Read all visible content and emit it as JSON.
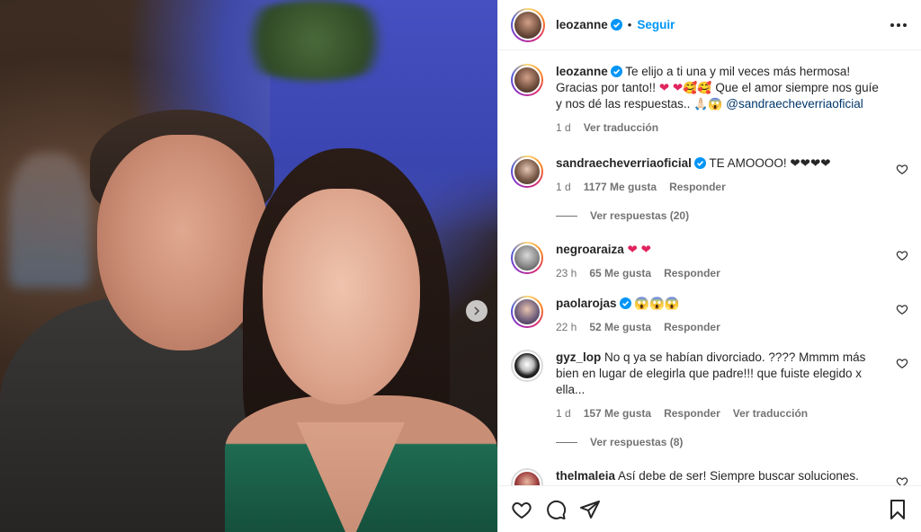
{
  "post": {
    "author": "leozanne",
    "follow_label": "Seguir",
    "dot": "•"
  },
  "caption": {
    "username": "leozanne",
    "text_a": "Te elijo a ti una y mil veces más hermosa! Gracias por tanto!! ",
    "hearts": "❤ ❤",
    "emojis": "🥰🥰",
    "text_b": " Que el amor siempre nos guíe y nos dé las respuestas.. ",
    "emoji_tail": "🙏🏻😱",
    "mention": "@sandraecheverriaoficial",
    "time": "1 d",
    "translate": "Ver traducción"
  },
  "comments": [
    {
      "username": "sandraecheverriaoficial",
      "verified": true,
      "text": "TE AMOOOO! ❤❤❤❤",
      "time": "1 d",
      "likes": "1177 Me gusta",
      "reply": "Responder",
      "translate": "",
      "replies": "Ver respuestas (20)"
    },
    {
      "username": "negroaraiza",
      "verified": false,
      "text": "❤ ❤",
      "time": "23 h",
      "likes": "65 Me gusta",
      "reply": "Responder",
      "translate": "",
      "replies": ""
    },
    {
      "username": "paolarojas",
      "verified": true,
      "text": "😱😱😱",
      "time": "22 h",
      "likes": "52 Me gusta",
      "reply": "Responder",
      "translate": "",
      "replies": ""
    },
    {
      "username": "gyz_lop",
      "verified": false,
      "text": "No q ya se habían divorciado. ???? Mmmm más bien en lugar de elegirla que padre!!! que fuiste elegido x ella...",
      "time": "1 d",
      "likes": "157 Me gusta",
      "reply": "Responder",
      "translate": "Ver traducción",
      "replies": "Ver respuestas (8)"
    },
    {
      "username": "thelmaleia",
      "verified": false,
      "text": "Así debe de ser! Siempre buscar soluciones. Puedes enamorarte muchas veces de la misma persona. Bien por",
      "time": "",
      "likes": "",
      "reply": "",
      "translate": "",
      "replies": ""
    }
  ],
  "icons": {
    "verified": "verified-badge-icon",
    "like": "heart-icon",
    "comment": "comment-icon",
    "share": "share-icon",
    "save": "bookmark-icon",
    "more": "more-options-icon",
    "next": "chevron-right-icon"
  },
  "colors": {
    "link": "#0095f6",
    "mention": "#00376b",
    "heart": "#e0245e",
    "muted": "#737373"
  }
}
